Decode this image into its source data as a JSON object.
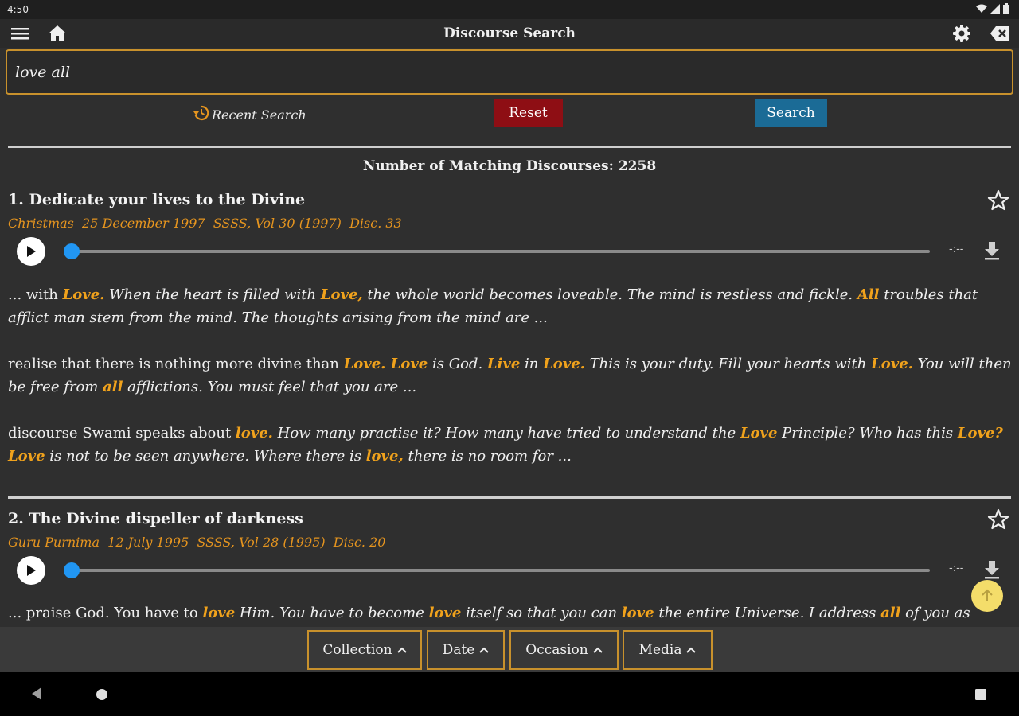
{
  "status_bar": {
    "time": "4:50"
  },
  "app_bar": {
    "title": "Discourse Search"
  },
  "search": {
    "value": "love all",
    "placeholder": ""
  },
  "actions": {
    "recent_label": "Recent Search",
    "reset_label": "Reset",
    "search_label": "Search"
  },
  "summary": {
    "matching_label": "Number of Matching Discourses: 2258"
  },
  "results": [
    {
      "title": "1. Dedicate your lives to the Divine",
      "meta": "Christmas  25 December 1997  SSSS, Vol 30 (1997)  Disc. 33",
      "duration": "-:--",
      "snippets": [
        [
          {
            "t": "...  with ",
            "h": false,
            "i": false
          },
          {
            "t": "Love.",
            "h": true
          },
          {
            "t": " When the heart is filled with ",
            "h": false,
            "i": true
          },
          {
            "t": "Love,",
            "h": true
          },
          {
            "t": " the whole world becomes loveable. The mind is restless and fickle. ",
            "h": false,
            "i": true
          },
          {
            "t": "All",
            "h": true
          },
          {
            "t": " troubles that afflict man stem from the mind. The thoughts arising from the mind are ...",
            "h": false,
            "i": true
          }
        ],
        [
          {
            "t": " realise that there is nothing more divine than ",
            "h": false,
            "i": false
          },
          {
            "t": "Love. Love",
            "h": true
          },
          {
            "t": " is God. ",
            "h": false,
            "i": true
          },
          {
            "t": "Live",
            "h": true
          },
          {
            "t": " in ",
            "h": false,
            "i": true
          },
          {
            "t": "Love.",
            "h": true
          },
          {
            "t": " This is your duty. Fill your hearts with ",
            "h": false,
            "i": true
          },
          {
            "t": "Love.",
            "h": true
          },
          {
            "t": " You will then be free from ",
            "h": false,
            "i": true
          },
          {
            "t": "all",
            "h": true
          },
          {
            "t": " afflictions. You must feel that you are ...",
            "h": false,
            "i": true
          }
        ],
        [
          {
            "t": " discourse Swami speaks about ",
            "h": false,
            "i": false
          },
          {
            "t": "love.",
            "h": true
          },
          {
            "t": " How many practise it? How many have tried to understand the ",
            "h": false,
            "i": true
          },
          {
            "t": "Love",
            "h": true
          },
          {
            "t": " Principle? Who has this ",
            "h": false,
            "i": true
          },
          {
            "t": "Love? Love",
            "h": true
          },
          {
            "t": " is not to be seen anywhere. Where there is ",
            "h": false,
            "i": true
          },
          {
            "t": "love,",
            "h": true
          },
          {
            "t": " there is no room for ...",
            "h": false,
            "i": true
          }
        ]
      ]
    },
    {
      "title": "2. The Divine dispeller of darkness",
      "meta": "Guru Purnima  12 July 1995  SSSS, Vol 28 (1995)  Disc. 20",
      "duration": "-:--",
      "snippets": [
        [
          {
            "t": "...  praise God. You have to ",
            "h": false,
            "i": false
          },
          {
            "t": "love",
            "h": true
          },
          {
            "t": " Him. You have to become ",
            "h": false,
            "i": true
          },
          {
            "t": "love",
            "h": true
          },
          {
            "t": " itself so that you can ",
            "h": false,
            "i": true
          },
          {
            "t": "love",
            "h": true
          },
          {
            "t": " the entire Universe. I address ",
            "h": false,
            "i": true
          },
          {
            "t": "all",
            "h": true
          },
          {
            "t": " of you as",
            "h": false,
            "i": true
          }
        ]
      ]
    }
  ],
  "filters": [
    {
      "label": "Collection"
    },
    {
      "label": "Date"
    },
    {
      "label": "Occasion"
    },
    {
      "label": "Media"
    }
  ],
  "colors": {
    "accent": "#c8912c",
    "highlight": "#f0a21c",
    "reset": "#8e0e14",
    "search": "#1b6b96",
    "progress": "#2196f3"
  }
}
